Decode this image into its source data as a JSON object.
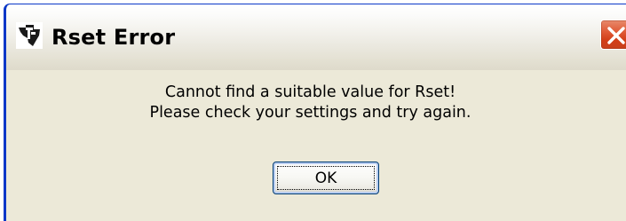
{
  "window": {
    "title": "Rset Error",
    "icon": "ti-logo-icon",
    "close_icon": "close-icon"
  },
  "message": {
    "line1": "Cannot find a suitable value for Rset!",
    "line2": "Please check your settings and try again."
  },
  "buttons": {
    "ok_label": "OK"
  },
  "colors": {
    "frame": "#0a37c8",
    "dialog_bg": "#ece9d8",
    "close_button": "#d23e18",
    "button_border": "#003c74"
  }
}
